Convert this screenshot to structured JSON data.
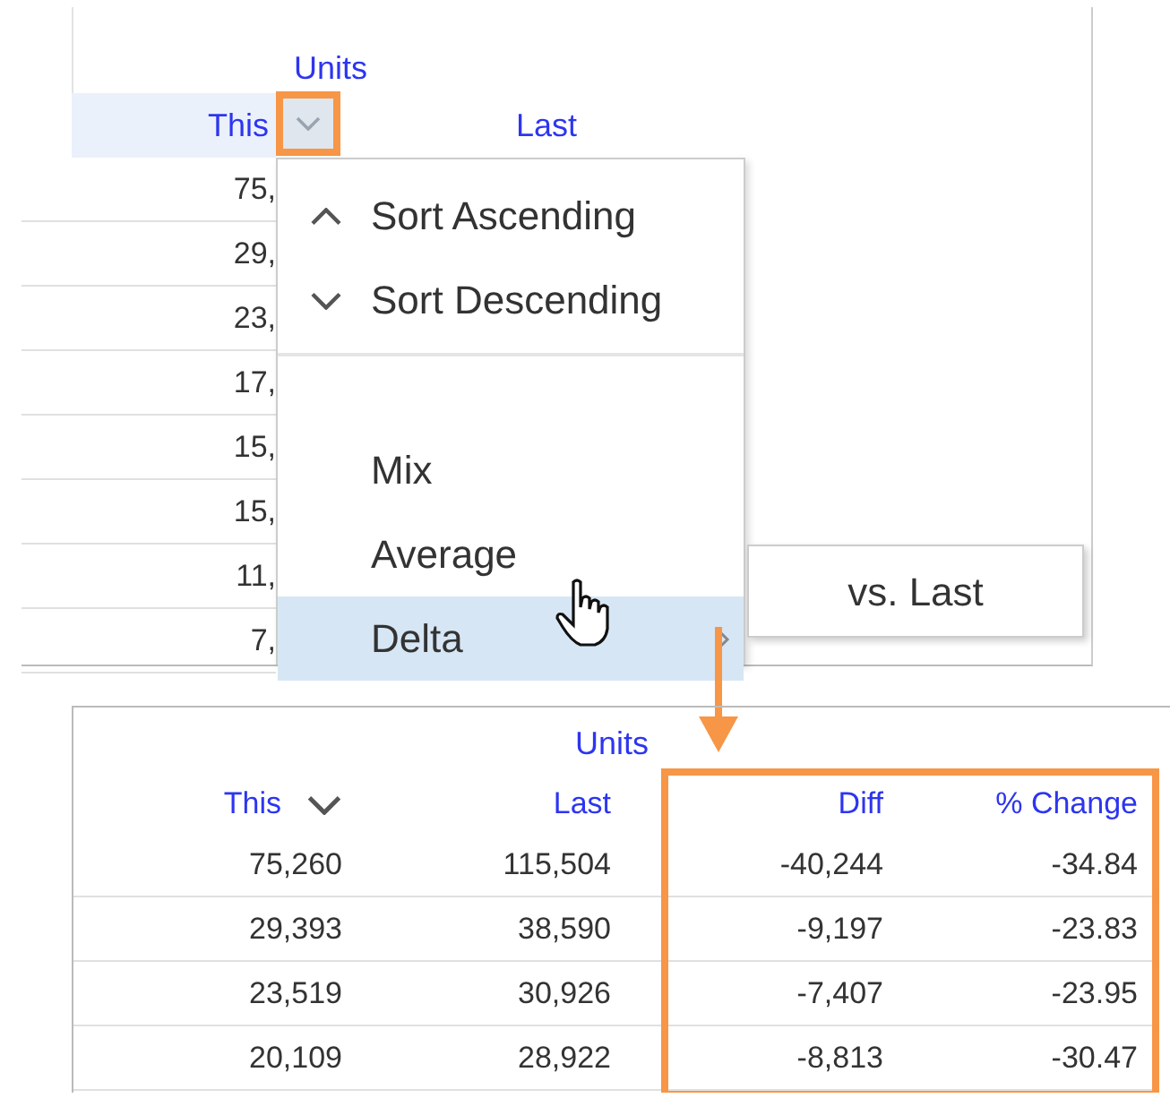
{
  "top_panel": {
    "group_header": "Units",
    "columns": [
      {
        "label": "This",
        "has_menu": true
      },
      {
        "label": "Last",
        "has_menu": false
      }
    ],
    "rows": [
      [
        "75,"
      ],
      [
        "29,"
      ],
      [
        "23,"
      ],
      [
        "17,"
      ],
      [
        "15,"
      ],
      [
        "15,"
      ],
      [
        "11,"
      ],
      [
        "7,"
      ]
    ],
    "menu": {
      "items": [
        {
          "kind": "sort-asc",
          "label": "Sort Ascending",
          "selected": false
        },
        {
          "kind": "sort-desc",
          "label": "Sort Descending",
          "selected": false
        },
        {
          "kind": "divider"
        },
        {
          "kind": "plain",
          "label": "Mix",
          "selected": false
        },
        {
          "kind": "plain",
          "label": "Average",
          "selected": false
        },
        {
          "kind": "submenu",
          "label": "Delta",
          "selected": true
        }
      ],
      "submenu": {
        "items": [
          "vs. Last"
        ]
      }
    }
  },
  "bottom_panel": {
    "group_header": "Units",
    "columns": [
      {
        "label": "This",
        "has_menu": true,
        "highlighted": false
      },
      {
        "label": "Last",
        "has_menu": false,
        "highlighted": false
      },
      {
        "label": "Diff",
        "has_menu": false,
        "highlighted": true
      },
      {
        "label": "% Change",
        "has_menu": false,
        "highlighted": true
      }
    ],
    "rows": [
      [
        "75,260",
        "115,504",
        "-40,244",
        "-34.84"
      ],
      [
        "29,393",
        "38,590",
        "-9,197",
        "-23.83"
      ],
      [
        "23,519",
        "30,926",
        "-7,407",
        "-23.95"
      ],
      [
        "20,109",
        "28,922",
        "-8,813",
        "-30.47"
      ]
    ]
  }
}
